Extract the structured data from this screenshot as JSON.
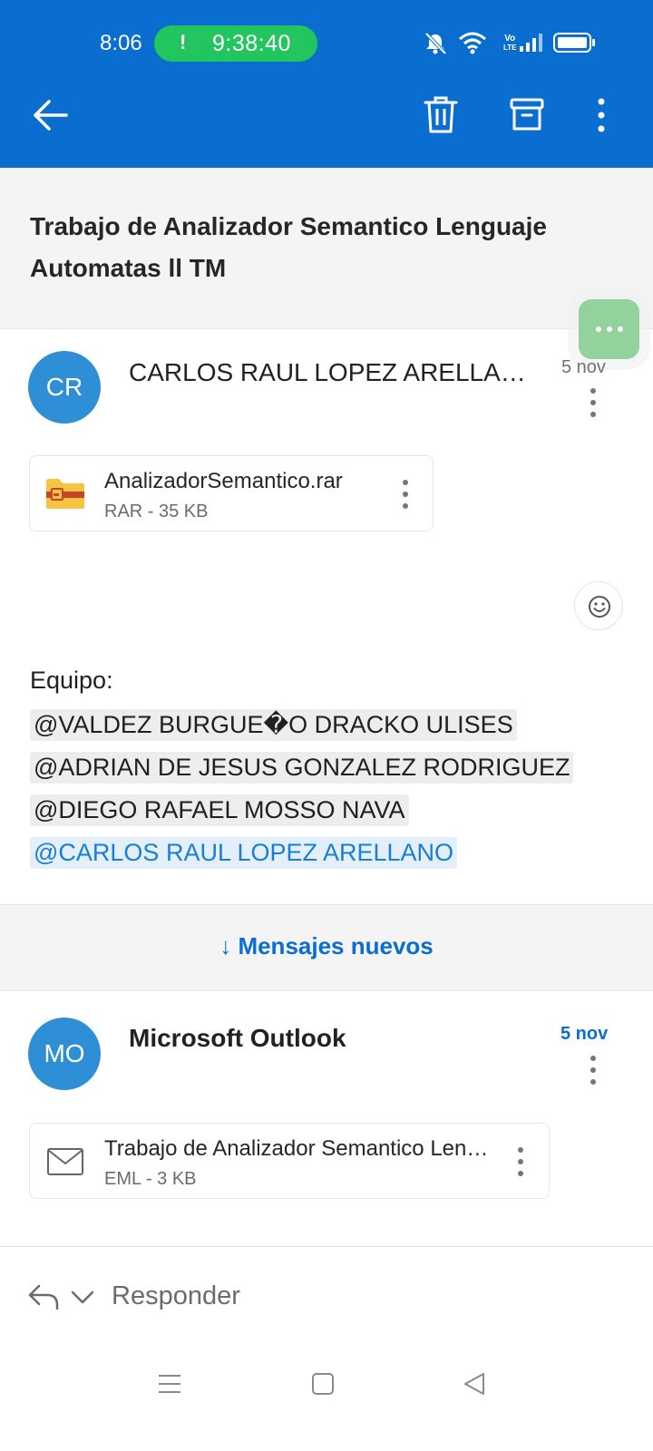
{
  "status_bar": {
    "time": "8:06",
    "call_indicator": "!",
    "call_timer": "9:38:40",
    "volte_label_top": "Vo",
    "volte_label_bottom": "LTE",
    "icons": [
      "mute-icon",
      "wifi-icon",
      "volte-icon",
      "signal-icon",
      "battery-icon"
    ]
  },
  "app_bar": {
    "icons": [
      "back-arrow-icon",
      "trash-icon",
      "archive-icon",
      "more-vertical-icon"
    ]
  },
  "thread": {
    "subject": "Trabajo de Analizador Semantico Lenguaje Automatas ll TM"
  },
  "messages": [
    {
      "avatar_initials": "CR",
      "sender": "CARLOS RAUL LOPEZ ARELLANO",
      "date": "5 nov",
      "attachment": {
        "name": "AnalizadorSemantico.rar",
        "meta": "RAR - 35 KB",
        "icon": "folder-zip-icon"
      },
      "body_heading": "Equipo:",
      "mentions": [
        "@VALDEZ BURGUE�O DRACKO ULISES",
        "@ADRIAN DE JESUS GONZALEZ RODRIGUEZ",
        "@DIEGO RAFAEL MOSSO NAVA",
        "@CARLOS RAUL LOPEZ ARELLANO"
      ]
    },
    {
      "avatar_initials": "MO",
      "sender": "Microsoft Outlook",
      "date": "5 nov",
      "attachment": {
        "name": "Trabajo de Analizador Semantico Lenguaje Automatas ll TM.eml",
        "meta": "EML - 3 KB",
        "icon": "envelope-icon"
      }
    }
  ],
  "new_messages_label": "↓ Mensajes nuevos",
  "reply": {
    "label": "Responder"
  },
  "colors": {
    "brand_blue": "#0a6ed1",
    "avatar_blue": "#2f8fd6",
    "call_green": "#22c55e",
    "fab_green": "#93d29d"
  }
}
